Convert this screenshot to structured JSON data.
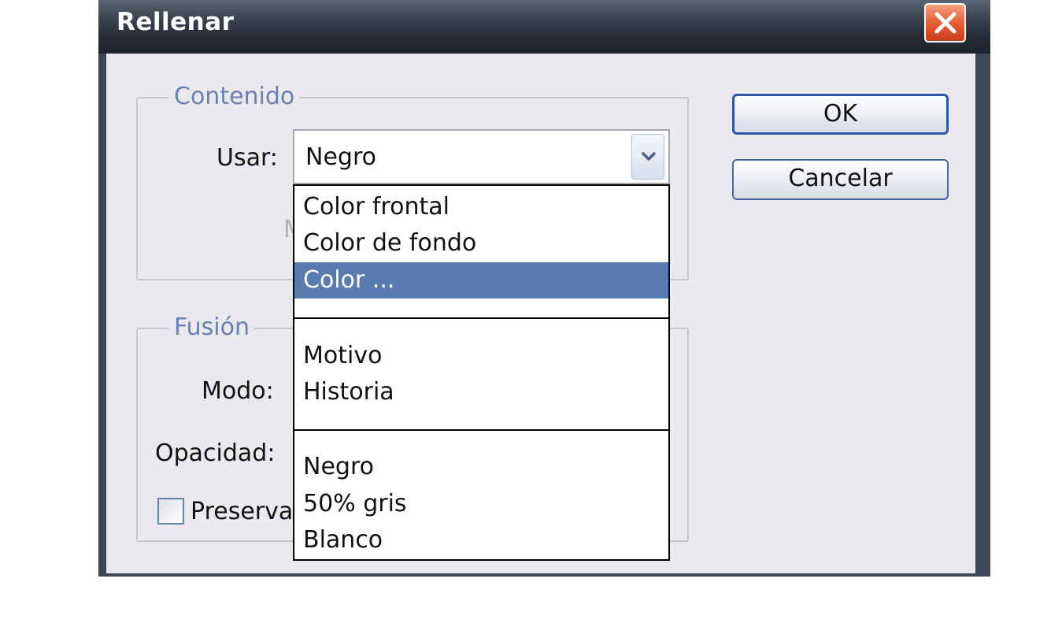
{
  "window": {
    "title": "Rellenar"
  },
  "buttons": {
    "ok_label": "OK",
    "cancel_label": "Cancelar"
  },
  "contenido": {
    "legend": "Contenido",
    "usar_label": "Usar:",
    "usar_value": "Negro",
    "hidden_label_fragment": "M"
  },
  "fusion": {
    "legend": "Fusión",
    "modo_label": "Modo:",
    "opacidad_label": "Opacidad:",
    "preserve_label": "Preserva",
    "preserve_checked": false
  },
  "dropdown": {
    "options": [
      {
        "label": "Color frontal",
        "selected": false
      },
      {
        "label": "Color de fondo",
        "selected": false
      },
      {
        "label": "Color ...",
        "selected": true
      },
      {
        "label": "Motivo",
        "selected": false
      },
      {
        "label": "Historia",
        "selected": false
      },
      {
        "label": "Negro",
        "selected": false
      },
      {
        "label": "50% gris",
        "selected": false
      },
      {
        "label": "Blanco",
        "selected": false
      }
    ]
  },
  "colors": {
    "selection": "#5a7bb0",
    "legend_text": "#6b7fb3",
    "dialog_bg": "#ebe9ed",
    "close_button": "#e45e34"
  }
}
